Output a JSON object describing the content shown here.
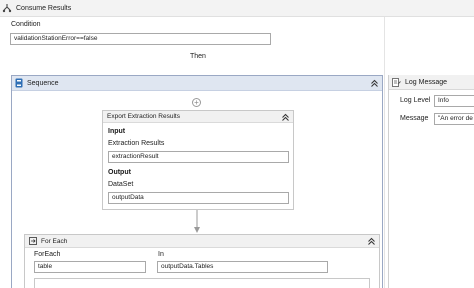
{
  "titlebar": {
    "title": "Consume Results"
  },
  "condition": {
    "label": "Condition",
    "value": "validationStationError==false"
  },
  "then_label": "Then",
  "sequence": {
    "title": "Sequence",
    "export_activity": {
      "title": "Export Extraction Results",
      "input_header": "Input",
      "extraction_label": "Extraction Results",
      "extraction_value": "extractionResult",
      "output_header": "Output",
      "dataset_label": "DataSet",
      "dataset_value": "outputData"
    },
    "foreach": {
      "title": "For Each",
      "foreach_label": "ForEach",
      "foreach_value": "table",
      "in_label": "In",
      "in_value": "outputData.Tables"
    }
  },
  "log_message": {
    "title": "Log Message",
    "level_label": "Log Level",
    "level_value": "Info",
    "message_label": "Message",
    "message_value": "\"An error de"
  },
  "colors": {
    "sequence_header": "#dfe6f1",
    "sequence_border": "#9aa8c4",
    "field_border": "#a9a9a9"
  },
  "icons": [
    "if-condition-icon",
    "sequence-icon",
    "collapse-icon",
    "add-activity-icon",
    "foreach-icon",
    "log-message-icon",
    "dropdown-arrow-icon"
  ]
}
